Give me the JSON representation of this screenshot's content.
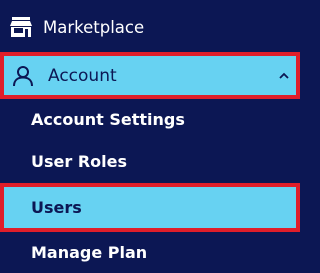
{
  "sidebar": {
    "marketplace": {
      "label": "Marketplace",
      "icon": "store-icon"
    },
    "account": {
      "label": "Account",
      "icon": "user-icon",
      "chevron": "chevron-up-icon",
      "expanded": true
    },
    "account_items": [
      {
        "label": "Account Settings"
      },
      {
        "label": "User Roles"
      },
      {
        "label": "Users",
        "selected": true
      },
      {
        "label": "Manage Plan"
      }
    ]
  },
  "colors": {
    "background": "#0c1754",
    "highlight": "#67d2f2",
    "highlight_border": "#e01e2a",
    "text": "#ffffff",
    "text_on_highlight": "#0c1754"
  }
}
